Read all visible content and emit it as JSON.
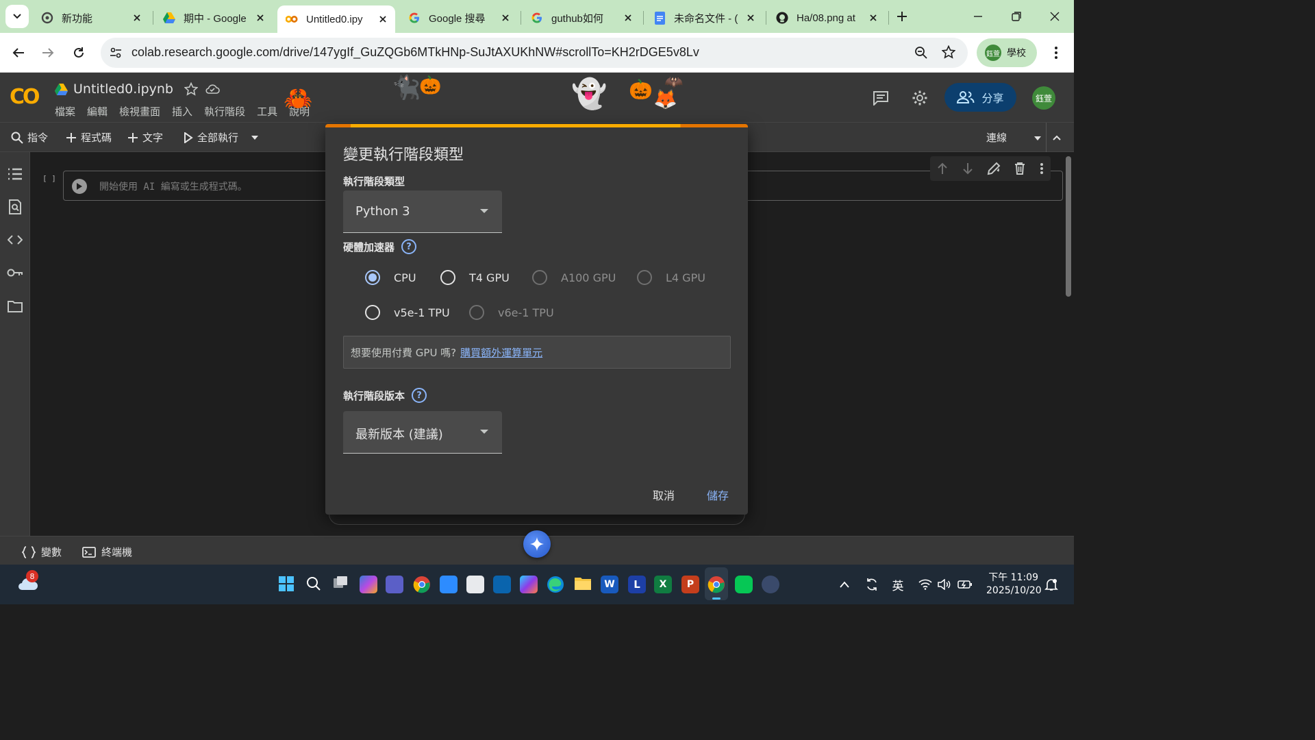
{
  "browser": {
    "tabs": [
      {
        "title": "新功能",
        "icon": "chrome-settings-icon"
      },
      {
        "title": "期中 - Google",
        "icon": "google-drive-icon"
      },
      {
        "title": "Untitled0.ipy",
        "icon": "colab-icon",
        "active": true
      },
      {
        "title": "Google 搜尋",
        "icon": "google-icon"
      },
      {
        "title": "guthub如何",
        "icon": "google-icon"
      },
      {
        "title": "未命名文件 - (",
        "icon": "google-docs-icon"
      },
      {
        "title": "Ha/08.png at",
        "icon": "github-icon"
      }
    ],
    "url": "colab.research.google.com/drive/147ygIf_GuZQGb6MTkHNp-SuJtAXUKhNW#scrollTo=KH2rDGE5v8Lv",
    "profile_label": "學校",
    "profile_initials": "鈺萱"
  },
  "colab": {
    "logo_text": "CO",
    "notebook_title": "Untitled0.ipynb",
    "menu": [
      "檔案",
      "編輯",
      "檢視畫面",
      "插入",
      "執行階段",
      "工具",
      "說明"
    ],
    "share_label": "分享",
    "user_initials": "鈺萱",
    "toolbar": {
      "commands": "指令",
      "add_code": "程式碼",
      "add_text": "文字",
      "run_all": "全部執行",
      "connect": "連線"
    },
    "cell": {
      "bracket": "[ ]",
      "placeholder": "開始使用 AI 編寫或生成程式碼。"
    },
    "status": {
      "variables": "變數",
      "terminal": "終端機"
    }
  },
  "dialog": {
    "title": "變更執行階段類型",
    "runtime_type_label": "執行階段類型",
    "runtime_type_value": "Python 3",
    "accelerator_label": "硬體加速器",
    "accelerators": [
      {
        "label": "CPU",
        "state": "checked"
      },
      {
        "label": "T4 GPU",
        "state": "enabled"
      },
      {
        "label": "A100 GPU",
        "state": "disabled"
      },
      {
        "label": "L4 GPU",
        "state": "disabled"
      },
      {
        "label": "v5e-1 TPU",
        "state": "enabled"
      },
      {
        "label": "v6e-1 TPU",
        "state": "disabled"
      }
    ],
    "notice_text": "想要使用付費 GPU 嗎?",
    "notice_link": "購買額外運算單元",
    "version_label": "執行階段版本",
    "version_value": "最新版本 (建議)",
    "cancel_label": "取消",
    "save_label": "儲存"
  },
  "taskbar": {
    "notification_count": "8",
    "ime": "英",
    "time": "下午 11:09",
    "date": "2025/10/20"
  },
  "colors": {
    "tab_strip": "#c5e6c3",
    "colab_bg": "#383838",
    "accent_link": "#8ab4f8",
    "colab_logo": "#f9ab00",
    "share_button": "#0c3f6e"
  }
}
